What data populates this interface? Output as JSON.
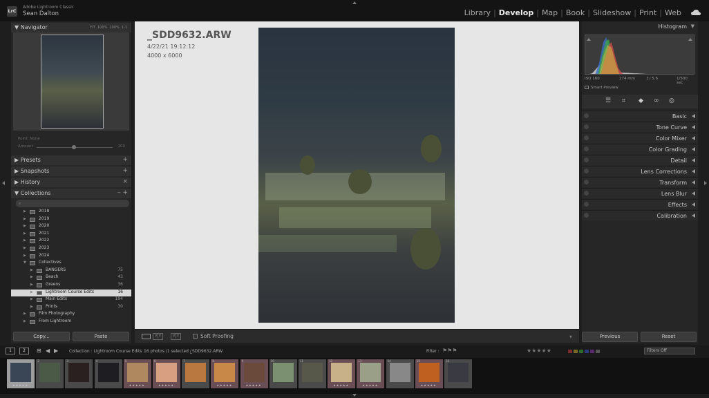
{
  "app": {
    "logo": "LrC",
    "name": "Adobe Lightroom Classic",
    "user": "Sean Dalton"
  },
  "modules": [
    {
      "label": "Library",
      "active": false
    },
    {
      "label": "Develop",
      "active": true
    },
    {
      "label": "Map",
      "active": false
    },
    {
      "label": "Book",
      "active": false
    },
    {
      "label": "Slideshow",
      "active": false
    },
    {
      "label": "Print",
      "active": false
    },
    {
      "label": "Web",
      "active": false
    }
  ],
  "navigator": {
    "title": "Navigator",
    "options": [
      "FIT",
      "100%",
      "100%",
      "1:1"
    ],
    "toggle": "▼"
  },
  "point": {
    "label": "Point: None",
    "amount_label": "Amount",
    "amount_value": "100"
  },
  "left_sections": [
    {
      "label": "Presets",
      "action": "+"
    },
    {
      "label": "Snapshots",
      "action": "+"
    },
    {
      "label": "History",
      "action": "×"
    },
    {
      "label": "Collections",
      "action": "– +"
    }
  ],
  "collections": [
    {
      "name": "2018",
      "count": "",
      "depth": 1
    },
    {
      "name": "2019",
      "count": "",
      "depth": 1
    },
    {
      "name": "2020",
      "count": "",
      "depth": 1
    },
    {
      "name": "2021",
      "count": "",
      "depth": 1
    },
    {
      "name": "2022",
      "count": "",
      "depth": 1
    },
    {
      "name": "2023",
      "count": "",
      "depth": 1
    },
    {
      "name": "2024",
      "count": "",
      "depth": 1
    },
    {
      "name": "Collectives",
      "count": "",
      "depth": 1,
      "open": true
    },
    {
      "name": "BANGERS",
      "count": "75",
      "depth": 2
    },
    {
      "name": "Beach",
      "count": "43",
      "depth": 2
    },
    {
      "name": "Greens",
      "count": "36",
      "depth": 2
    },
    {
      "name": "Lightroom Course Edits",
      "count": "16",
      "depth": 2,
      "selected": true
    },
    {
      "name": "Main Edits",
      "count": "194",
      "depth": 2
    },
    {
      "name": "Prints",
      "count": "30",
      "depth": 2
    },
    {
      "name": "Film Photography",
      "count": "",
      "depth": 1
    },
    {
      "name": "From Lightroom",
      "count": "",
      "depth": 1
    }
  ],
  "left_buttons": {
    "copy": "Copy...",
    "paste": "Paste"
  },
  "image_info": {
    "filename": "_SDD9632.ARW",
    "datetime": "4/22/21 19:12:12",
    "dimensions": "4000 x 6000"
  },
  "toolbar": {
    "soft_proofing": "Soft Proofing",
    "yy": "Y|Y"
  },
  "histogram": {
    "title": "Histogram",
    "iso": "ISO 160",
    "focal": "274 mm",
    "aperture": "ƒ / 5.6",
    "shutter": "1/500 sec",
    "smart_preview": "Smart Preview"
  },
  "develop_panels": [
    "Basic",
    "Tone Curve",
    "Color Mixer",
    "Color Grading",
    "Detail",
    "Lens Corrections",
    "Transform",
    "Lens Blur",
    "Effects",
    "Calibration"
  ],
  "right_buttons": {
    "previous": "Previous",
    "reset": "Reset"
  },
  "filmbar": {
    "page1": "1",
    "page2": "2",
    "collection": "Collection : Lightroom Course Edits",
    "count": "16 photos /1 selected /",
    "selected_file": "_SDD9632.ARW",
    "filter_label": "Filter :",
    "rating": "★★★★★",
    "filters_off": "Filters Off"
  },
  "filmstrip": [
    {
      "num": "",
      "flag": false,
      "selected": true,
      "color": "#3a4656",
      "stars": "★★★★★"
    },
    {
      "num": "2",
      "flag": false,
      "selected": false,
      "color": "#4a5a46",
      "stars": ""
    },
    {
      "num": "3",
      "flag": false,
      "selected": false,
      "color": "#2a2020",
      "stars": ""
    },
    {
      "num": "4",
      "flag": false,
      "selected": false,
      "color": "#1e1e22",
      "stars": ""
    },
    {
      "num": "5",
      "flag": true,
      "selected": false,
      "color": "#b08860",
      "stars": "★★★★★"
    },
    {
      "num": "6",
      "flag": true,
      "selected": false,
      "color": "#d8a080",
      "stars": "★★★★★"
    },
    {
      "num": "7",
      "flag": false,
      "selected": false,
      "color": "#b87840",
      "stars": ""
    },
    {
      "num": "8",
      "flag": true,
      "selected": false,
      "color": "#c88848",
      "stars": "★★★★★"
    },
    {
      "num": "9",
      "flag": true,
      "selected": false,
      "color": "#6a4a3a",
      "stars": "★★★★★"
    },
    {
      "num": "10",
      "flag": false,
      "selected": false,
      "color": "#7a9070",
      "stars": ""
    },
    {
      "num": "11",
      "flag": false,
      "selected": false,
      "color": "#58584a",
      "stars": ""
    },
    {
      "num": "12",
      "flag": true,
      "selected": false,
      "color": "#c8b088",
      "stars": "★★★★★"
    },
    {
      "num": "13",
      "flag": true,
      "selected": false,
      "color": "#9aa088",
      "stars": "★★★★★"
    },
    {
      "num": "14",
      "flag": false,
      "selected": false,
      "color": "#888888",
      "stars": ""
    },
    {
      "num": "15",
      "flag": true,
      "selected": false,
      "color": "#c06020",
      "stars": "★★★★★"
    },
    {
      "num": "16",
      "flag": false,
      "selected": false,
      "color": "#3a3a42",
      "stars": ""
    }
  ],
  "colors": {
    "accent": "#ececec",
    "panel": "#262626",
    "flag": "#6a4e56"
  }
}
